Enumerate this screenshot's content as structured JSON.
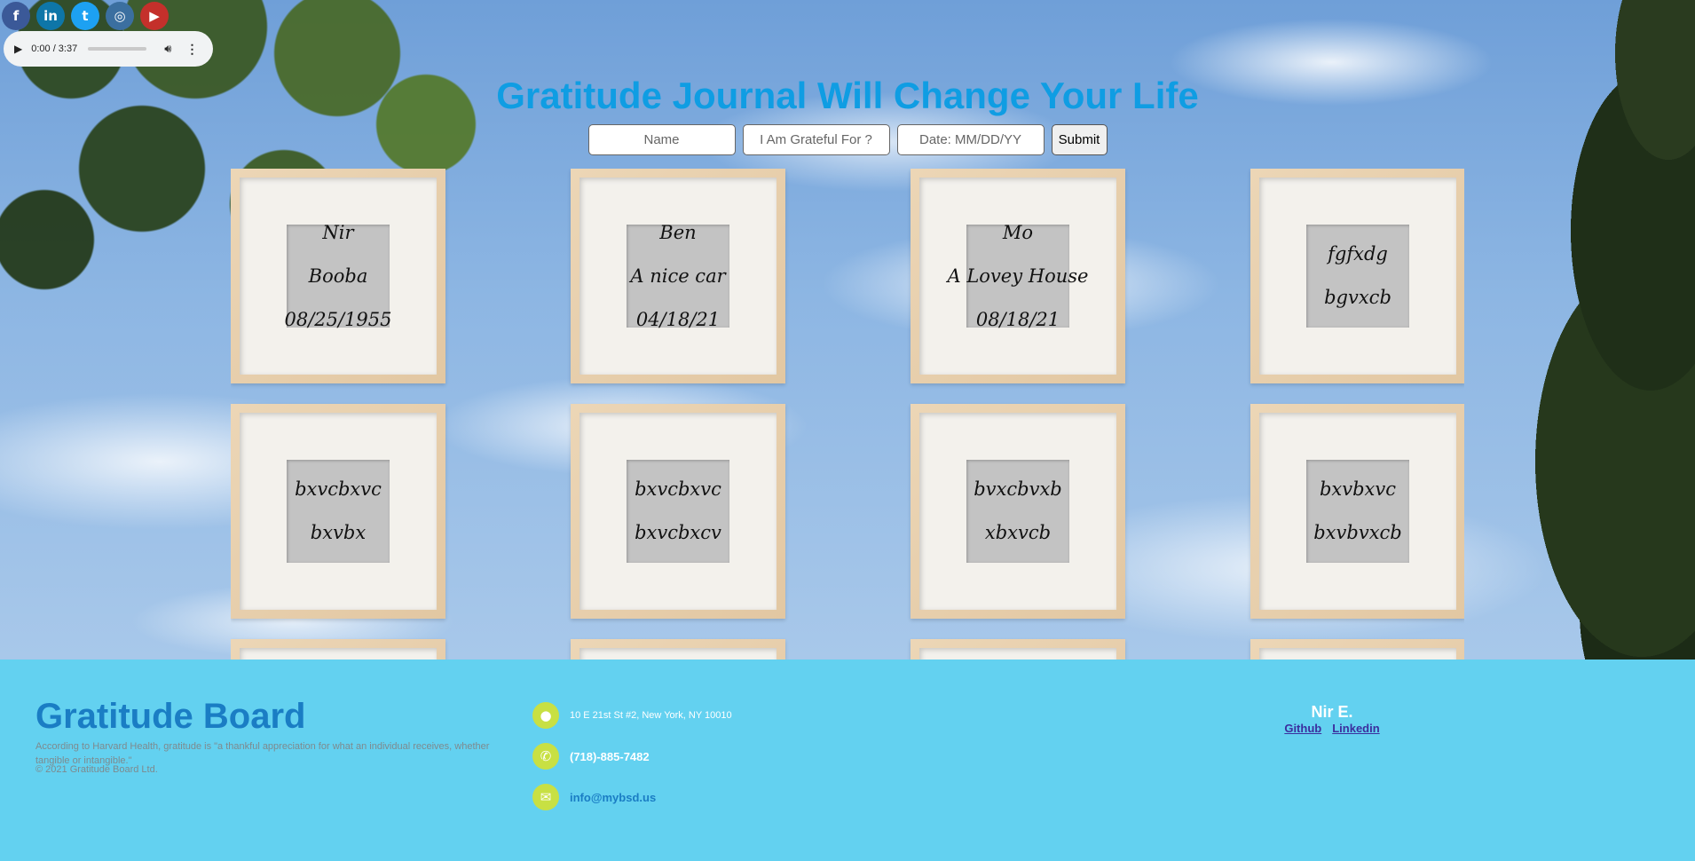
{
  "social": [
    {
      "name": "facebook",
      "glyph": "f",
      "icon": "facebook-icon"
    },
    {
      "name": "linkedin",
      "glyph": "in",
      "icon": "linkedin-icon"
    },
    {
      "name": "twitter",
      "glyph": "t",
      "icon": "twitter-icon"
    },
    {
      "name": "instagram",
      "glyph": "◎",
      "icon": "instagram-icon"
    },
    {
      "name": "youtube",
      "glyph": "▶",
      "icon": "youtube-icon"
    }
  ],
  "audio": {
    "time": "0:00 / 3:37",
    "progress": 0
  },
  "title": "Gratitude Journal Will Change Your Life",
  "form": {
    "name_placeholder": "Name",
    "grateful_placeholder": "I Am Grateful For ?",
    "date_placeholder": "Date: MM/DD/YY",
    "submit_label": "Submit"
  },
  "cards": [
    {
      "lines": [
        "Nir",
        "Booba",
        "08/25/1955"
      ]
    },
    {
      "lines": [
        "Ben",
        "A nice car",
        "04/18/21"
      ]
    },
    {
      "lines": [
        "Mo",
        "A Lovey House",
        "08/18/21"
      ]
    },
    {
      "lines": [
        "fgfxdg",
        "bgvxcb"
      ]
    },
    {
      "lines": [
        "bxvcbxvc",
        "bxvbx"
      ]
    },
    {
      "lines": [
        "bxvcbxvc",
        "bxvcbxcv"
      ]
    },
    {
      "lines": [
        "bvxcbvxb",
        "xbxvcb"
      ]
    },
    {
      "lines": [
        "bxvbxvc",
        "bxvbvxcb"
      ]
    },
    {
      "lines": []
    },
    {
      "lines": []
    },
    {
      "lines": []
    },
    {
      "lines": []
    }
  ],
  "footer": {
    "brand": "Gratitude Board",
    "quote": "According to Harvard Health, gratitude is \"a thankful appreciation for what an individual receives, whether tangible or intangible.\"",
    "copyright": "© 2021 Gratitude Board Ltd.",
    "address": "10 E 21st St #2, New York, NY 10010",
    "phone": "(718)-885-7482",
    "email": "info@mybsd.us",
    "author": "Nir E.",
    "github": "Github",
    "linkedin": "Linkedin"
  },
  "colors": {
    "title": "#0f9de3",
    "footer_bg": "#63d1f0",
    "brand": "#1a7dc4",
    "contact_icon": "#c8e043"
  }
}
